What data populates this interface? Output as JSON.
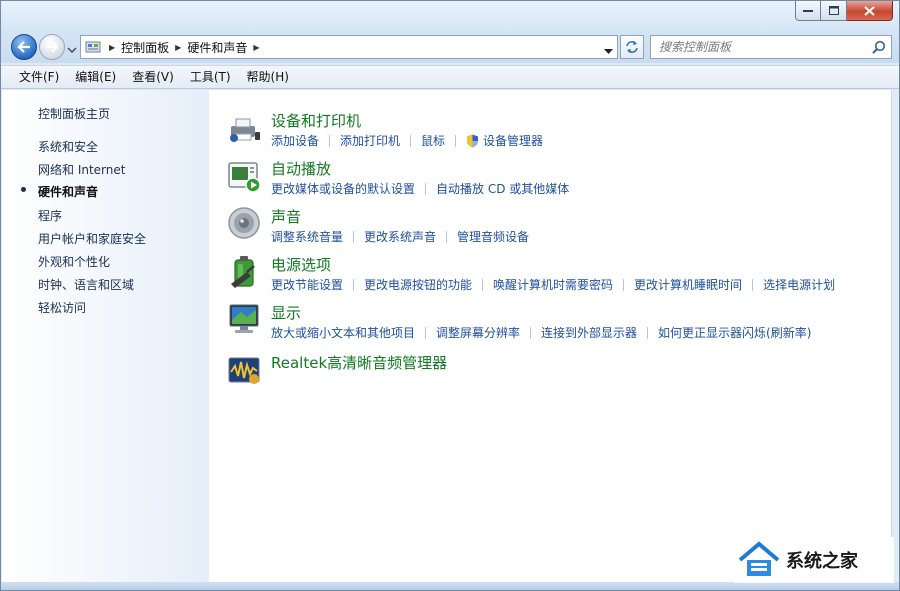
{
  "window": {
    "caption": {
      "minimize": "minimize",
      "maximize": "maximize",
      "close": "close"
    }
  },
  "address": {
    "crumbs": [
      "控制面板",
      "硬件和声音"
    ],
    "search_placeholder": "搜索控制面板"
  },
  "menu": {
    "items": [
      "文件(F)",
      "编辑(E)",
      "查看(V)",
      "工具(T)",
      "帮助(H)"
    ]
  },
  "sidebar": {
    "home": "控制面板主页",
    "items": [
      {
        "label": "系统和安全",
        "active": false
      },
      {
        "label": "网络和 Internet",
        "active": false
      },
      {
        "label": "硬件和声音",
        "active": true
      },
      {
        "label": "程序",
        "active": false
      },
      {
        "label": "用户帐户和家庭安全",
        "active": false
      },
      {
        "label": "外观和个性化",
        "active": false
      },
      {
        "label": "时钟、语言和区域",
        "active": false
      },
      {
        "label": "轻松访问",
        "active": false
      }
    ]
  },
  "categories": [
    {
      "title": "设备和打印机",
      "icon": "printer-icon",
      "links": [
        "添加设备",
        "添加打印机",
        "鼠标",
        "设备管理器"
      ]
    },
    {
      "title": "自动播放",
      "icon": "autoplay-icon",
      "links": [
        "更改媒体或设备的默认设置",
        "自动播放 CD 或其他媒体"
      ]
    },
    {
      "title": "声音",
      "icon": "speaker-icon",
      "links": [
        "调整系统音量",
        "更改系统声音",
        "管理音频设备"
      ]
    },
    {
      "title": "电源选项",
      "icon": "power-icon",
      "links": [
        "更改节能设置",
        "更改电源按钮的功能",
        "唤醒计算机时需要密码",
        "更改计算机睡眠时间",
        "选择电源计划"
      ]
    },
    {
      "title": "显示",
      "icon": "monitor-icon",
      "links": [
        "放大或缩小文本和其他项目",
        "调整屏幕分辨率",
        "连接到外部显示器",
        "如何更正显示器闪烁(刷新率)"
      ]
    },
    {
      "title": "Realtek高清晰音频管理器",
      "icon": "realtek-audio-icon",
      "links": []
    }
  ],
  "watermark": {
    "text": "系统之家"
  },
  "colors": {
    "category_title": "#127a22",
    "link": "#1f4f9c",
    "sidebar_link": "#1b2f52"
  }
}
